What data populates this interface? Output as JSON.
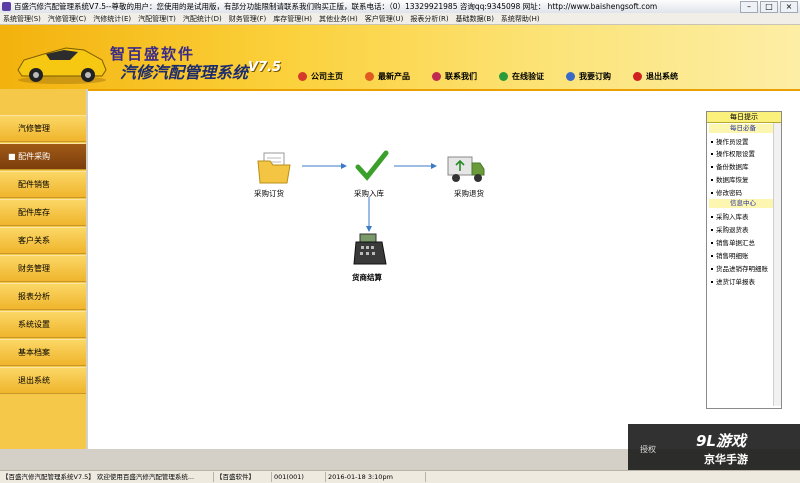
{
  "window": {
    "title": "百盛汽修汽配管理系统V7.5--尊敬的用户：您使用的是试用版，有部分功能限制请联系我们购买正版，联系电话：（0）13329921985 咨询qq:9345098  网址： http://www.baishengsoft.com",
    "controls": [
      "–",
      "□",
      "×"
    ]
  },
  "menubar": [
    "系统管理(S)",
    "汽修管理(C)",
    "汽修统计(E)",
    "汽配管理(T)",
    "汽配统计(D)",
    "财务管理(F)",
    "库存管理(H)",
    "其他业务(H)",
    "客户管理(U)",
    "报表分析(R)",
    "基础数据(B)",
    "系统帮助(H)"
  ],
  "header": {
    "brand": "智百盛软件",
    "system_name": "汽修汽配管理系统",
    "version": "V7.5",
    "links": [
      {
        "label": "公司主页",
        "icon": "home-icon",
        "color": "#d43a2a"
      },
      {
        "label": "最新产品",
        "icon": "product-icon",
        "color": "#e05a20"
      },
      {
        "label": "联系我们",
        "icon": "contact-icon",
        "color": "#c02a50"
      },
      {
        "label": "在线验证",
        "icon": "verify-icon",
        "color": "#2a9a3a"
      },
      {
        "label": "我要订购",
        "icon": "order-icon",
        "color": "#3a6ac8"
      },
      {
        "label": "退出系统",
        "icon": "exit-icon",
        "color": "#d02020"
      }
    ]
  },
  "sidebar": [
    {
      "label": "汽修管理",
      "active": false
    },
    {
      "label": "■ 配件采购",
      "active": true
    },
    {
      "label": "配件销售",
      "active": false
    },
    {
      "label": "配件库存",
      "active": false
    },
    {
      "label": "客户关系",
      "active": false
    },
    {
      "label": "财务管理",
      "active": false
    },
    {
      "label": "报表分析",
      "active": false
    },
    {
      "label": "系统设置",
      "active": false
    },
    {
      "label": "基本档案",
      "active": false
    },
    {
      "label": "退出系统",
      "active": false
    }
  ],
  "flow": {
    "order": "采购订货",
    "stockin": "采购入库",
    "return": "采购退货",
    "settle": "货商结算"
  },
  "right_panel": {
    "title": "每日提示",
    "section1": "每日必备",
    "items1": [
      "操作员设置",
      "操作权限设置",
      "备份数据库",
      "数据库恢复",
      "修改密码"
    ],
    "section2": "信息中心",
    "items2": [
      "采购入库表",
      "采购退货表",
      "销售单据汇总",
      "销售明细账",
      "货品进销存明细账",
      "进货订单报表"
    ]
  },
  "statusbar": {
    "app": "【百盛汽修汽配管理系统V7.5】 欢迎使用百盛汽修汽配管理系统...",
    "company": "【百盛软件】",
    "user": "001(001)",
    "datetime": "2016-01-18  3:10pm"
  },
  "watermark": {
    "partial": "授权",
    "big": "9L游戏",
    "small": "京华手游"
  }
}
